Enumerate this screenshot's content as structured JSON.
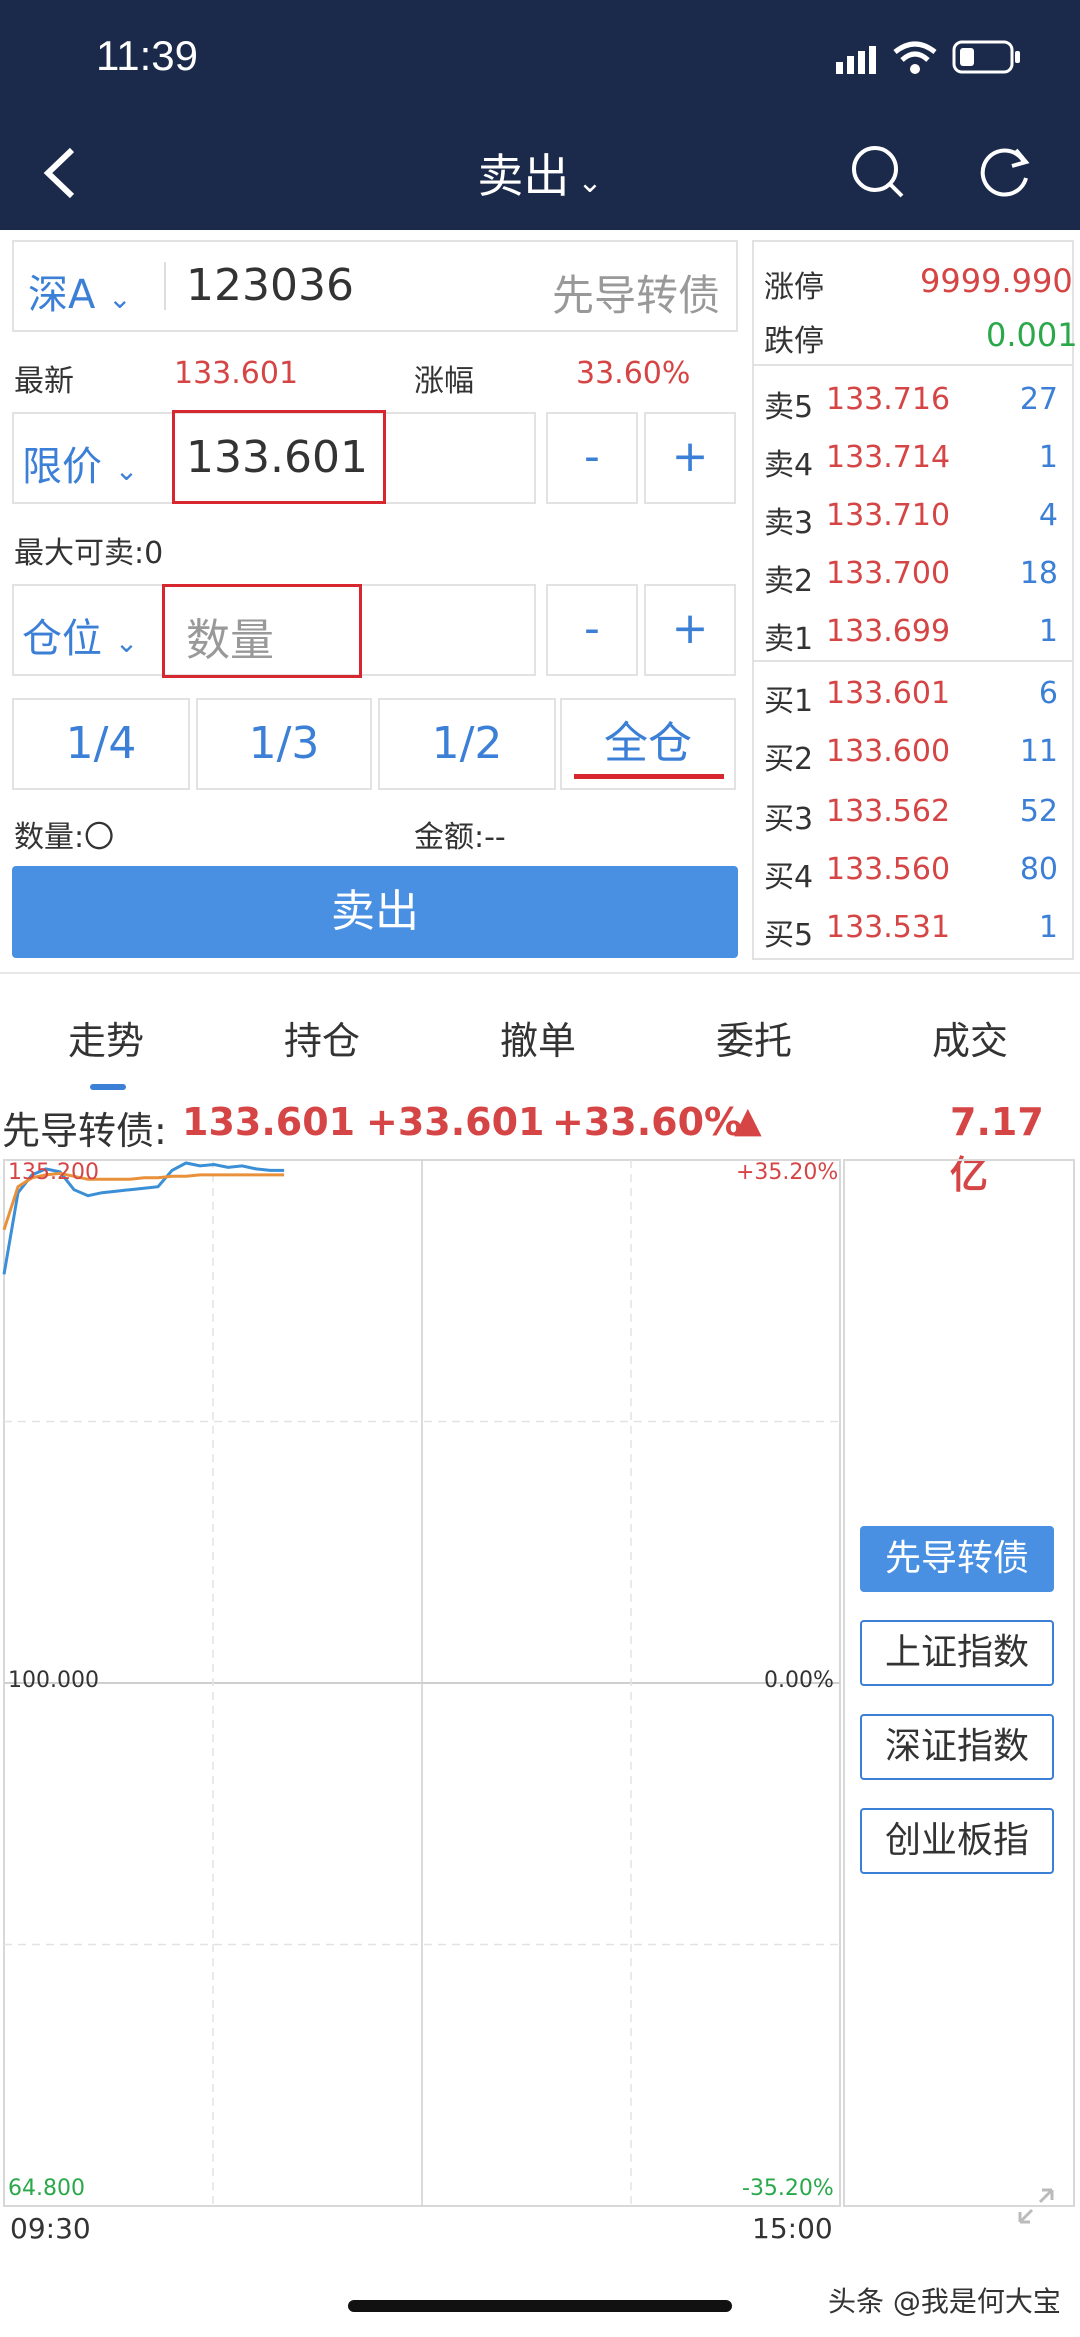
{
  "status": {
    "time": "11:39"
  },
  "nav": {
    "title": "卖出"
  },
  "form": {
    "market": "深A",
    "code": "123036",
    "name": "先导转债",
    "latest_label": "最新",
    "latest_value": "133.601",
    "change_label": "涨幅",
    "change_value": "33.60%",
    "price_type": "限价",
    "price_value": "133.601",
    "minus": "-",
    "plus": "+",
    "max_sell": "最大可卖:0",
    "position_type": "仓位",
    "qty_placeholder": "数量",
    "fractions": [
      "1/4",
      "1/3",
      "1/2",
      "全仓"
    ],
    "qty_label": "数量:〇",
    "amount_label": "金额:--",
    "submit": "卖出"
  },
  "orderbook": {
    "limit_up_label": "涨停",
    "limit_up_value": "9999.990",
    "limit_down_label": "跌停",
    "limit_down_value": "0.001",
    "asks": [
      {
        "label": "卖5",
        "price": "133.716",
        "vol": "27"
      },
      {
        "label": "卖4",
        "price": "133.714",
        "vol": "1"
      },
      {
        "label": "卖3",
        "price": "133.710",
        "vol": "4"
      },
      {
        "label": "卖2",
        "price": "133.700",
        "vol": "18"
      },
      {
        "label": "卖1",
        "price": "133.699",
        "vol": "1"
      }
    ],
    "bids": [
      {
        "label": "买1",
        "price": "133.601",
        "vol": "6"
      },
      {
        "label": "买2",
        "price": "133.600",
        "vol": "11"
      },
      {
        "label": "买3",
        "price": "133.562",
        "vol": "52"
      },
      {
        "label": "买4",
        "price": "133.560",
        "vol": "80"
      },
      {
        "label": "买5",
        "price": "133.531",
        "vol": "1"
      }
    ]
  },
  "tabs": [
    "走势",
    "持仓",
    "撤单",
    "委托",
    "成交"
  ],
  "quote": {
    "name": "先导转债:",
    "price": "133.601",
    "change": "+33.601",
    "pct": "+33.60%",
    "arrow": "▲",
    "turnover": "7.17亿"
  },
  "chart_data": {
    "type": "line",
    "y_labels_left": [
      "135.200",
      "100.000",
      "64.800"
    ],
    "y_labels_right": [
      "+35.20%",
      "0.00%",
      "-35.20%"
    ],
    "x_labels": [
      "09:30",
      "15:00"
    ],
    "ylim": [
      64.8,
      135.2
    ],
    "series": [
      {
        "color": "#3a8fd6",
        "values": [
          127.5,
          133.0,
          134.2,
          134.6,
          134.4,
          133.2,
          132.8,
          133.0,
          133.1,
          133.2,
          133.3,
          133.4,
          134.5,
          135.0,
          134.8,
          134.9,
          134.7,
          134.8,
          134.6,
          134.5,
          134.5
        ]
      },
      {
        "color": "#e8913a",
        "values": [
          130.5,
          133.4,
          134.0,
          134.2,
          134.3,
          134.1,
          133.9,
          133.9,
          133.9,
          133.9,
          134.0,
          134.0,
          134.1,
          134.1,
          134.2,
          134.2,
          134.2,
          134.2,
          134.2,
          134.2,
          134.2
        ]
      }
    ]
  },
  "indices": [
    "先导转债",
    "上证指数",
    "深证指数",
    "创业板指"
  ],
  "watermark": "头条 @我是何大宝",
  "colors": {
    "accent": "#3b7fd6",
    "up": "#d64545",
    "down": "#2aa84a",
    "nav": "#1b2a4a"
  }
}
